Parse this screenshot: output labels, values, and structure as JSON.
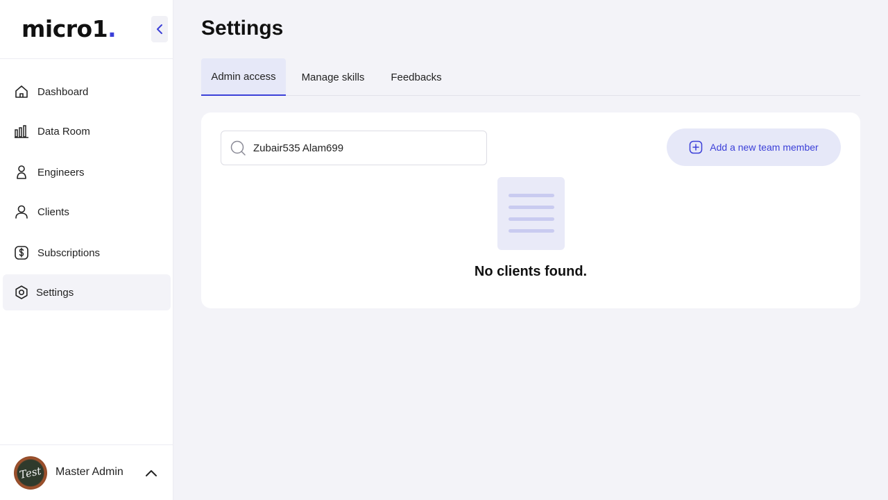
{
  "app": {
    "logo_text": "micro1",
    "logo_dot": ".",
    "brand_color": "#3b3fd8"
  },
  "sidebar": {
    "items": [
      {
        "label": "Dashboard",
        "icon": "home-icon",
        "active": false
      },
      {
        "label": "Data Room",
        "icon": "bar-chart-icon",
        "active": false
      },
      {
        "label": "Engineers",
        "icon": "engineer-icon",
        "active": false
      },
      {
        "label": "Clients",
        "icon": "user-icon",
        "active": false
      },
      {
        "label": "Subscriptions",
        "icon": "dollar-icon",
        "active": false
      },
      {
        "label": "Settings",
        "icon": "settings-icon",
        "active": true
      }
    ],
    "user": {
      "name": "Master Admin",
      "avatar_text": "Test"
    }
  },
  "main": {
    "title": "Settings",
    "tabs": [
      {
        "label": "Admin access",
        "active": true
      },
      {
        "label": "Manage skills",
        "active": false
      },
      {
        "label": "Feedbacks",
        "active": false
      }
    ],
    "search": {
      "value": "Zubair535 Alam699"
    },
    "add_button_label": "Add a new team member",
    "empty_message": "No clients found."
  }
}
